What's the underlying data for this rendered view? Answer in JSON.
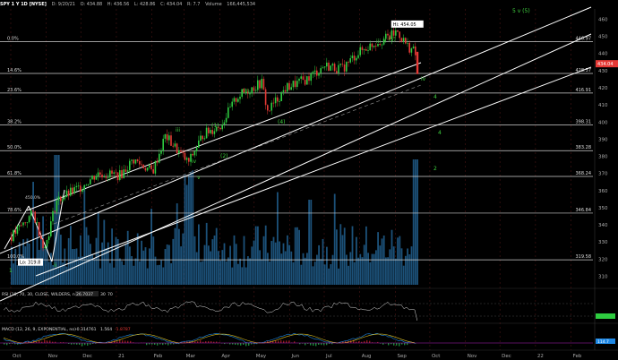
{
  "header": {
    "symbol": "SPY 1 Y 1D [NYSE]",
    "date": "D: 9/20/21",
    "open": "O: 434.88",
    "high": "H: 436.56",
    "low": "L: 428.86",
    "close": "C: 434.04",
    "change": "R: 7.7",
    "volume_label": "Volume",
    "volume": "166,445,534"
  },
  "colors": {
    "background": "#000000",
    "candle_up": "#2ecc40",
    "candle_down": "#e53935",
    "volume": "#1f5a86",
    "fib_line": "#cfcfcf",
    "channel": "#ffffff",
    "wave_label": "#3fd13f",
    "price_tag": "#e53935"
  },
  "chart_data": [
    {
      "type": "line",
      "name": "price",
      "x_ticks": [
        "Oct",
        "Nov",
        "Dec",
        "21",
        "Feb",
        "Mar",
        "Apr",
        "May",
        "Jun",
        "Jul",
        "Aug",
        "Sep",
        "Oct",
        "Nov",
        "Dec",
        "22",
        "Feb"
      ],
      "y_ticks": [
        310,
        320,
        330,
        340,
        350,
        360,
        370,
        380,
        390,
        400,
        410,
        420,
        430,
        440,
        450,
        460
      ],
      "ylim": [
        305,
        466
      ],
      "x": [
        "2020-10-01",
        "2020-10-20",
        "2020-10-30",
        "2020-11-09",
        "2020-11-30",
        "2020-12-15",
        "2021-01-04",
        "2021-01-15",
        "2021-02-01",
        "2021-02-12",
        "2021-03-04",
        "2021-03-17",
        "2021-04-01",
        "2021-04-16",
        "2021-05-07",
        "2021-05-12",
        "2021-05-28",
        "2021-06-15",
        "2021-07-01",
        "2021-07-16",
        "2021-07-29",
        "2021-08-13",
        "2021-08-27",
        "2021-09-02",
        "2021-09-10",
        "2021-09-17",
        "2021-09-20"
      ],
      "close": [
        333,
        347,
        326,
        354,
        362,
        370,
        369,
        378,
        371,
        392,
        376,
        393,
        398,
        415,
        423,
        406,
        420,
        425,
        433,
        431,
        440,
        446,
        450,
        453,
        445,
        441,
        434
      ],
      "current_price": "434.04",
      "fib_levels": [
        {
          "label": "0.0%",
          "value": "446.97"
        },
        {
          "label": "14.6%",
          "value": "428.37"
        },
        {
          "label": "23.6%",
          "value": "416.91"
        },
        {
          "label": "38.2%",
          "value": "398.31"
        },
        {
          "label": "50.0%",
          "value": "383.28"
        },
        {
          "label": "61.8%",
          "value": "368.24"
        },
        {
          "label": "78.6%",
          "value": "346.84"
        },
        {
          "label": "100.0%",
          "value": "319.58"
        }
      ],
      "annotations": {
        "high": "Hi: 454.05",
        "low": "Lo: 319.8",
        "wave_labels": [
          "(3)",
          "(4)",
          "(1)",
          "(2)",
          "iii",
          "iv",
          "v",
          "ii",
          "1",
          "2",
          "iii",
          "iv",
          "v (5)",
          "4",
          "4",
          "5 v (5)"
        ],
        "small_label": "450.0%"
      }
    },
    {
      "type": "bar",
      "name": "volume"
    },
    {
      "type": "line",
      "name": "rsi",
      "label": "RSI (10, 70, 30, CLOSE, WILDERS, no)",
      "value": "26.7037",
      "levels": [
        "30",
        "70"
      ]
    },
    {
      "type": "line",
      "name": "macd",
      "label": "MACD (12, 26, 9, EXPONENTIAL, no)",
      "values": [
        "-0.314761",
        "1.564",
        "-1.8787"
      ],
      "axis_tag": "114.7"
    }
  ]
}
